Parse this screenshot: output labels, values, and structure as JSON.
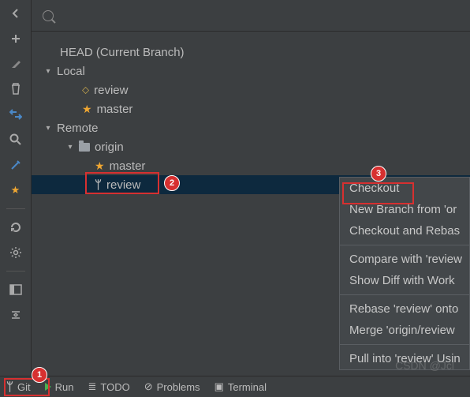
{
  "tree": {
    "head": "HEAD (Current Branch)",
    "local": "Local",
    "local_review": "review",
    "local_master": "master",
    "remote": "Remote",
    "origin": "origin",
    "origin_master": "master",
    "origin_review": "review"
  },
  "menu": {
    "checkout": "Checkout",
    "new_branch": "New Branch from 'or",
    "checkout_rebase": "Checkout and Rebas",
    "compare": "Compare with 'review",
    "show_diff": "Show Diff with Work",
    "rebase": "Rebase 'review' onto",
    "merge": "Merge 'origin/review",
    "pull": "Pull into 'review' Usin"
  },
  "bottom": {
    "git": "Git",
    "run": "Run",
    "todo": "TODO",
    "problems": "Problems",
    "terminal": "Terminal"
  },
  "callouts": {
    "c1": "1",
    "c2": "2",
    "c3": "3"
  },
  "watermark": "CSDN @Jcl"
}
